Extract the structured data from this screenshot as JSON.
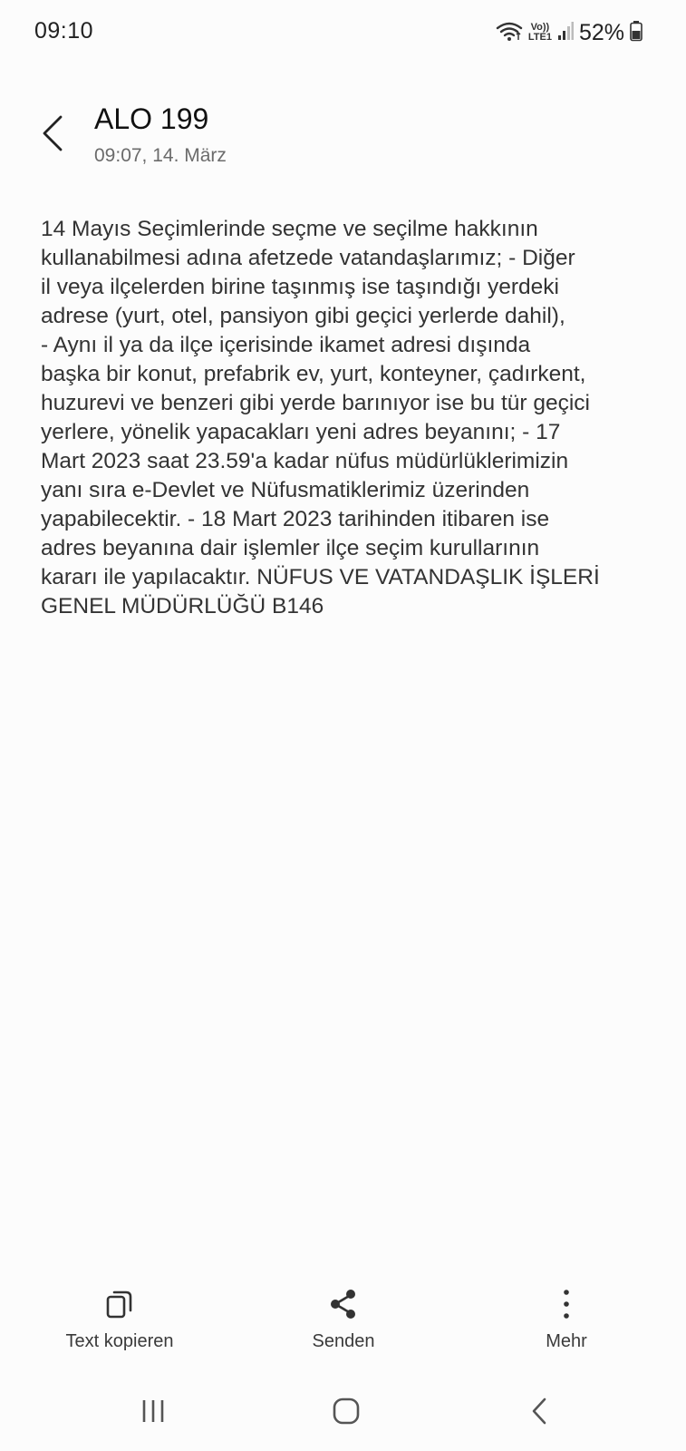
{
  "status_bar": {
    "time": "09:10",
    "battery": "52%",
    "icons": [
      "wifi-icon",
      "volte-lte-icon",
      "signal-icon",
      "battery-icon"
    ],
    "volte_top": "Vo))",
    "volte_bottom": "LTE1"
  },
  "header": {
    "back_icon": "chevron-left-icon",
    "sender": "ALO 199",
    "timestamp": "09:07, 14. März"
  },
  "message": {
    "text": "14 Mayıs Seçimlerinde seçme ve seçilme hakkının\nkullanabilmesi adına afetzede vatandaşlarımız; - Diğer\nil veya ilçelerden birine taşınmış ise taşındığı yerdeki\nadrese (yurt, otel, pansiyon gibi geçici yerlerde dahil),\n- Aynı il ya da ilçe içerisinde ikamet adresi dışında\nbaşka bir konut, prefabrik ev, yurt, konteyner, çadırkent,\nhuzurevi ve benzeri gibi yerde barınıyor ise bu tür geçici\nyerlere, yönelik yapacakları yeni adres beyanını; - 17\nMart 2023 saat 23.59'a kadar nüfus müdürlüklerimizin\nyanı sıra e-Devlet ve Nüfusmatiklerimiz üzerinden\nyapabilecektir. - 18 Mart 2023 tarihinden itibaren ise\nadres beyanına dair işlemler ilçe seçim kurullarının\nkararı ile yapılacaktır. NÜFUS VE VATANDAŞLIK İŞLERİ\nGENEL MÜDÜRLÜĞÜ B146"
  },
  "actions": [
    {
      "icon": "copy-icon",
      "label": "Text kopieren"
    },
    {
      "icon": "share-icon",
      "label": "Senden"
    },
    {
      "icon": "more-vertical-icon",
      "label": "Mehr"
    }
  ],
  "navbar": {
    "icons": [
      "recents-icon",
      "home-icon",
      "back-icon"
    ]
  },
  "colors": {
    "background": "#fcfcfc",
    "text_primary": "#111111",
    "text_secondary": "#6b6b6b"
  }
}
